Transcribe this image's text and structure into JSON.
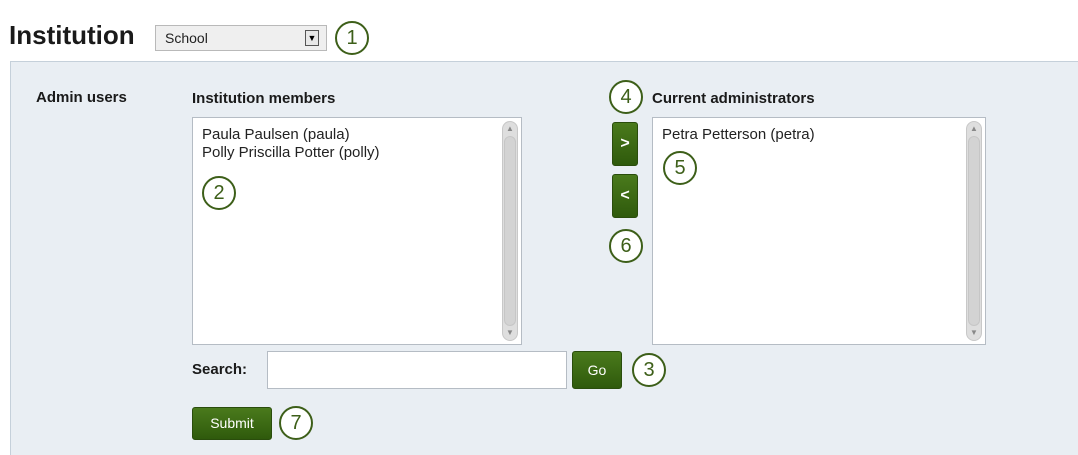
{
  "header": {
    "title": "Institution",
    "institution_select": {
      "value": "School",
      "arrow": "▼"
    }
  },
  "form": {
    "section_label": "Admin users",
    "members": {
      "label": "Institution members",
      "items": [
        "Paula Paulsen (paula)",
        "Polly Priscilla Potter (polly)"
      ]
    },
    "admins": {
      "label": "Current administrators",
      "items": [
        "Petra Petterson (petra)"
      ]
    },
    "move_right_label": ">",
    "move_left_label": "<",
    "search": {
      "label": "Search:",
      "value": "",
      "placeholder": ""
    },
    "go_label": "Go",
    "submit_label": "Submit"
  },
  "callouts": [
    "1",
    "2",
    "3",
    "4",
    "5",
    "6",
    "7"
  ],
  "colors": {
    "accent_green": "#3d5f19",
    "button_green": "#2f5a0c",
    "panel_bg": "#e9eef3"
  },
  "icons": {
    "scroll_up": "scroll-up-icon",
    "scroll_down": "scroll-down-icon",
    "dropdown": "dropdown-arrow-icon"
  }
}
